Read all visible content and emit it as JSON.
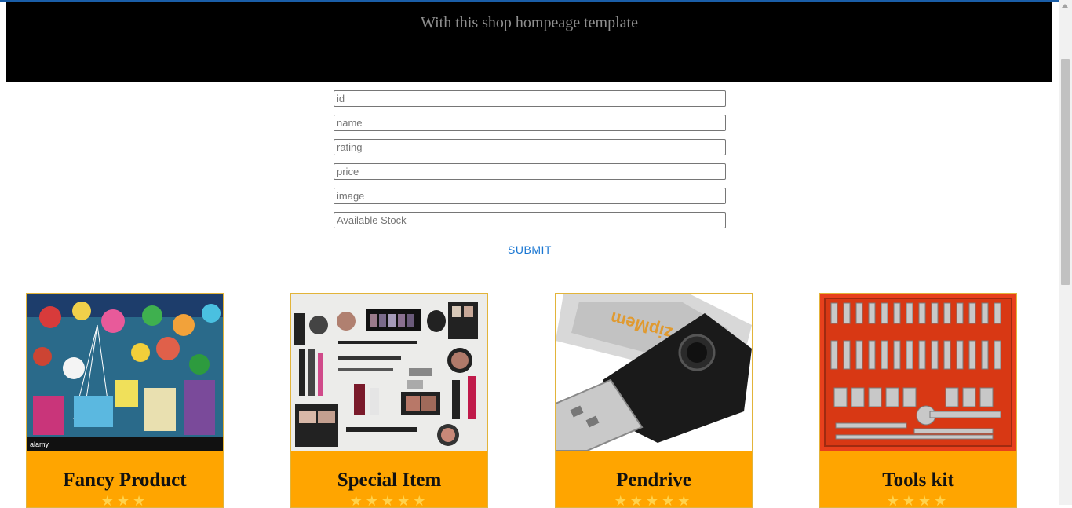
{
  "hero": {
    "subtitle": "With this shop hompeage template"
  },
  "form": {
    "fields": [
      {
        "placeholder": "id"
      },
      {
        "placeholder": "name"
      },
      {
        "placeholder": "rating"
      },
      {
        "placeholder": "price"
      },
      {
        "placeholder": "image"
      },
      {
        "placeholder": "Available Stock"
      }
    ],
    "submit_label": "SUBMIT"
  },
  "products": [
    {
      "name": "Fancy Product",
      "stars": "★★★",
      "image_icon": "toys-market-image"
    },
    {
      "name": "Special Item",
      "stars": "★★★★★",
      "image_icon": "makeup-set-image"
    },
    {
      "name": "Pendrive",
      "stars": "★★★★★",
      "image_icon": "usb-drive-image"
    },
    {
      "name": "Tools kit",
      "stars": "★★★★",
      "image_icon": "socket-set-image"
    }
  ],
  "colors": {
    "accent": "#1976d2",
    "card_band": "#ffa500",
    "hero_bg": "#000000",
    "card_border": "#e2b43a"
  }
}
